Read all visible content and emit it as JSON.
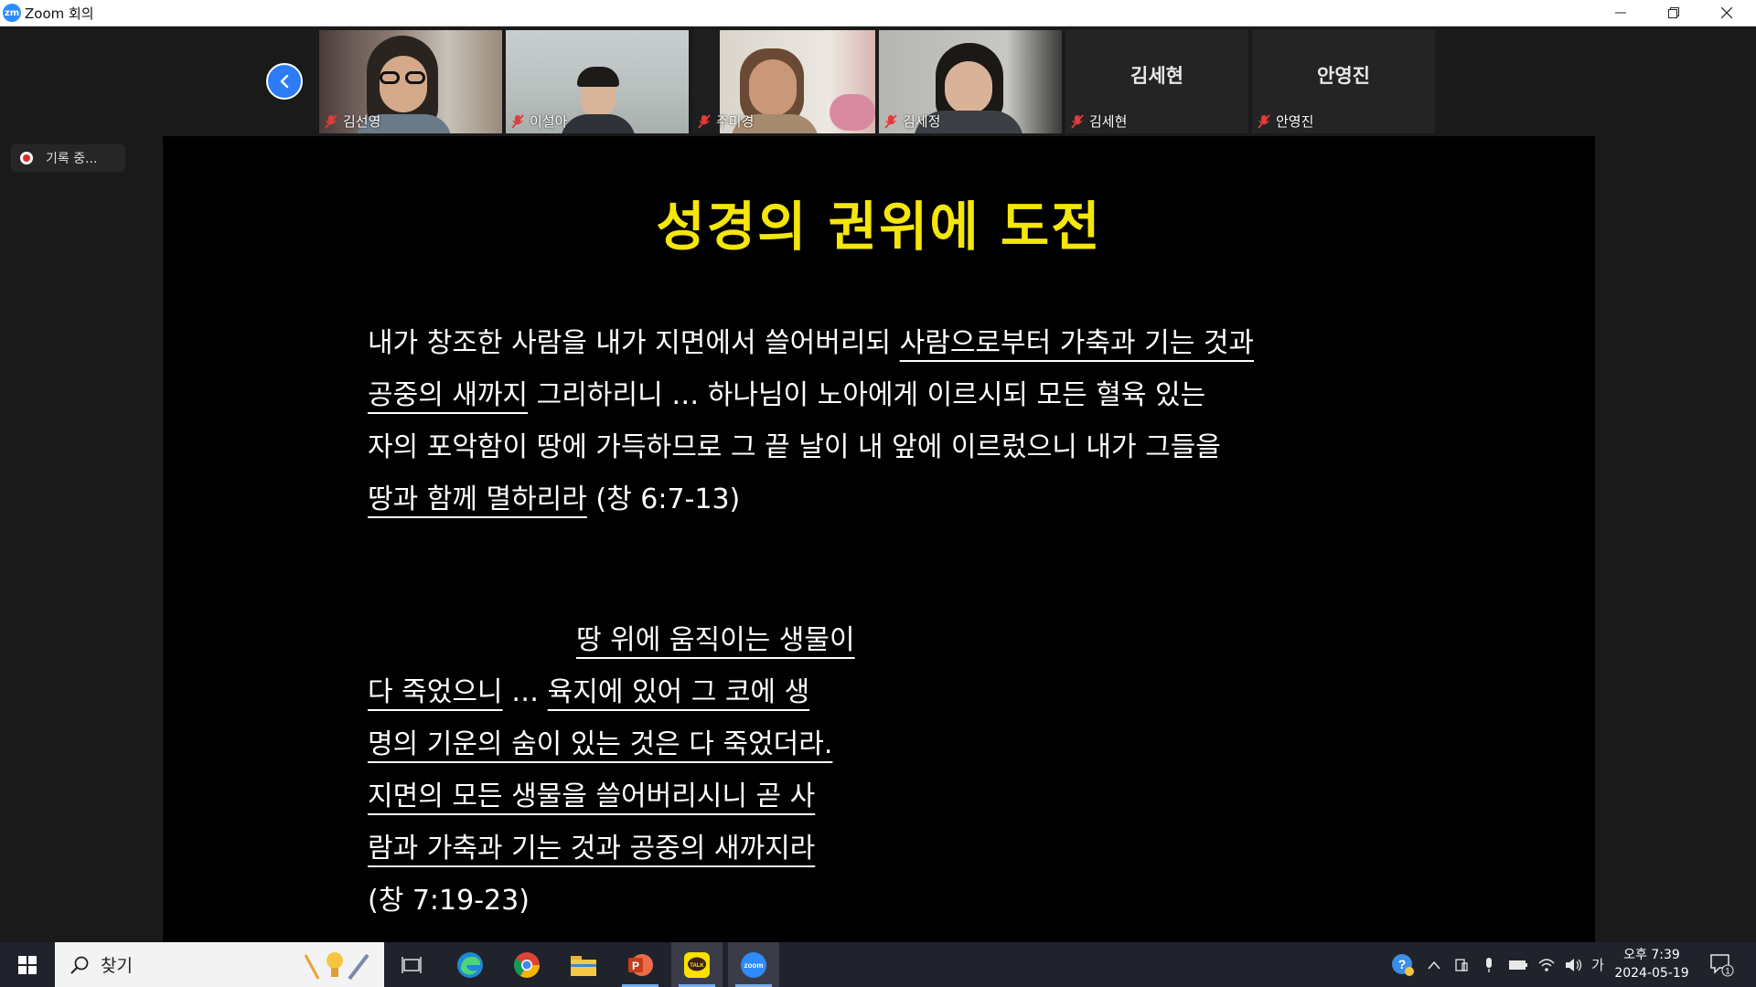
{
  "window": {
    "title": "Zoom 회의",
    "logo_text": "zm"
  },
  "recording": {
    "label": "기록 중..."
  },
  "participants": [
    {
      "name": "김선영",
      "muted": true,
      "video": true
    },
    {
      "name": "이설아",
      "muted": true,
      "video": true
    },
    {
      "name": "주미경",
      "muted": true,
      "video": true
    },
    {
      "name": "김세정",
      "muted": true,
      "video": true
    },
    {
      "name": "김세현",
      "muted": true,
      "video": false,
      "display_name": "김세현"
    },
    {
      "name": "안영진",
      "muted": true,
      "video": false,
      "display_name": "안영진"
    }
  ],
  "slide": {
    "title": "성경의 권위에 도전",
    "para1": {
      "s1": "내가 창조한 사람을 내가 지면에서 쓸어버리되 ",
      "s2": "사람으로부터 가축과 기는 것과",
      "s3": "공중의 새까지",
      "s4": " 그리하리니  …  하나님이 노아에게 이르시되 모든 혈육 있는",
      "s5": "자의 포악함이 땅에 가득하므로 그 끝 날이 내 앞에 이르렀으니 내가 그들을",
      "s6": "땅과 함께 멸하리라",
      "s7": " (창 6:7-13)"
    },
    "para2": {
      "s1": "땅 위에 움직이는 생물이",
      "s2": "다 죽었으니",
      "s3": " … ",
      "s4": "육지에 있어 그 코에 생",
      "s5": "명의 기운의 숨이 있는 것은 다 죽었더라.",
      "s6": "지면의 모든 생물을 쓸어버리시니 곧 사",
      "s7": "람과 가축과 기는 것과 공중의 새까지라",
      "s8": "(창 7:19-23)"
    }
  },
  "taskbar": {
    "search_placeholder": "찾기",
    "apps": [
      "task-view",
      "edge",
      "chrome",
      "file-explorer",
      "powerpoint",
      "kakaotalk",
      "zoom"
    ],
    "ime": "가",
    "clock_time": "오후 7:39",
    "clock_date": "2024-05-19",
    "notification_count": "1"
  },
  "colors": {
    "slide_title": "#f5e60a",
    "accent": "#2d8cff",
    "taskbar": "#20232c"
  }
}
